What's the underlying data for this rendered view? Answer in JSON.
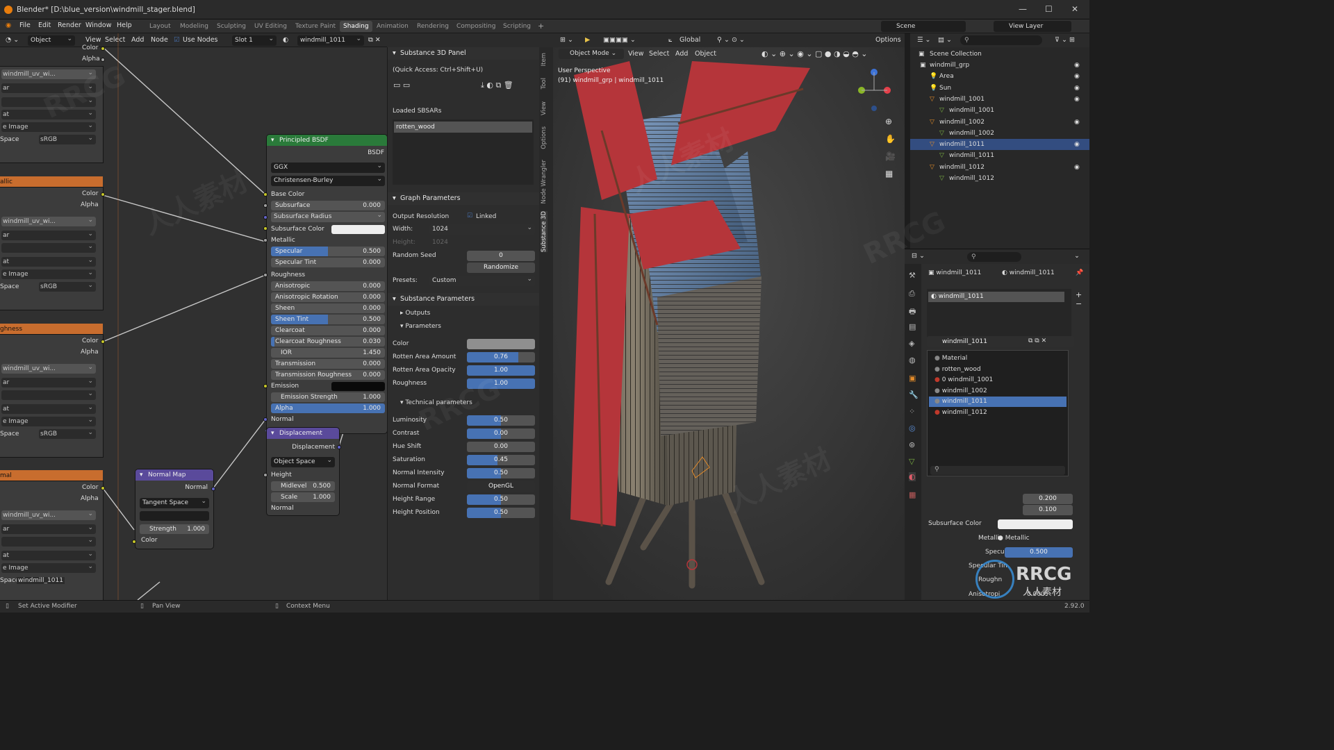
{
  "window": {
    "title": "Blender* [D:\\blue_version\\windmill_stager.blend]",
    "controls": [
      "—",
      "☐",
      "✕"
    ]
  },
  "menu": {
    "items": [
      "File",
      "Edit",
      "Render",
      "Window",
      "Help"
    ]
  },
  "workspaces": [
    "Layout",
    "Modeling",
    "Sculpting",
    "UV Editing",
    "Texture Paint",
    "Shading",
    "Animation",
    "Rendering",
    "Compositing",
    "Scripting"
  ],
  "active_workspace": "Shading",
  "scene": {
    "scene": "Scene",
    "view_layer": "View Layer"
  },
  "node_header": {
    "object": "Object",
    "view": "View",
    "select": "Select",
    "add": "Add",
    "node": "Node",
    "use_nodes": "Use Nodes",
    "slot": "Slot 1",
    "material": "windmill_1011"
  },
  "image_nodes": {
    "color": "Color",
    "alpha": "Alpha",
    "image": "windmill_uv_wi...",
    "space_label": "Space",
    "space": "sRGB",
    "image_label": "e Image",
    "r1": "ar",
    "r2": "at",
    "metallic_title": "allic",
    "roughness_title": "ghness",
    "normal_title": "mal",
    "top_color": "Color"
  },
  "principled": {
    "title": "Principled BSDF",
    "bsdf": "BSDF",
    "distribution": "GGX",
    "subsurface_method": "Christensen-Burley",
    "base_color": "Base Color",
    "subsurface": {
      "label": "Subsurface",
      "value": "0.000"
    },
    "subsurface_radius": "Subsurface Radius",
    "subsurface_color": "Subsurface Color",
    "metallic": "Metallic",
    "specular": {
      "label": "Specular",
      "value": "0.500"
    },
    "specular_tint": {
      "label": "Specular Tint",
      "value": "0.000"
    },
    "roughness": "Roughness",
    "anisotropic": {
      "label": "Anisotropic",
      "value": "0.000"
    },
    "anisotropic_rotation": {
      "label": "Anisotropic Rotation",
      "value": "0.000"
    },
    "sheen": {
      "label": "Sheen",
      "value": "0.000"
    },
    "sheen_tint": {
      "label": "Sheen Tint",
      "value": "0.500"
    },
    "clearcoat": {
      "label": "Clearcoat",
      "value": "0.000"
    },
    "clearcoat_roughness": {
      "label": "Clearcoat Roughness",
      "value": "0.030"
    },
    "ior": {
      "label": "IOR",
      "value": "1.450"
    },
    "transmission": {
      "label": "Transmission",
      "value": "0.000"
    },
    "transmission_roughness": {
      "label": "Transmission Roughness",
      "value": "0.000"
    },
    "emission": "Emission",
    "emission_strength": {
      "label": "Emission Strength",
      "value": "1.000"
    },
    "alpha": {
      "label": "Alpha",
      "value": "1.000"
    },
    "normal": "Normal"
  },
  "displacement": {
    "title": "Displacement",
    "out": "Displacement",
    "space": "Object Space",
    "height": "Height",
    "midlevel": {
      "label": "Midlevel",
      "value": "0.500"
    },
    "scale": {
      "label": "Scale",
      "value": "1.000"
    },
    "normal": "Normal"
  },
  "normal_map": {
    "title": "Normal Map",
    "normal": "Normal",
    "space": "Tangent Space",
    "strength": {
      "label": "Strength",
      "value": "1.000"
    },
    "color": "Color"
  },
  "bottom_overlay": "windmill_1011",
  "substance": {
    "panel_title": "Substance 3D Panel",
    "quick_access": "(Quick Access: Ctrl+Shift+U)",
    "loaded_label": "Loaded SBSARs",
    "loaded_item": "rotten_wood",
    "graph_title": "Graph Parameters",
    "output_res": "Output Resolution",
    "linked": "Linked",
    "width_label": "Width:",
    "width": "1024",
    "height_label": "Height:",
    "height": "1024",
    "seed_label": "Random Seed",
    "seed": "0",
    "randomize": "Randomize",
    "presets_label": "Presets:",
    "presets": "Custom",
    "params_title": "Substance Parameters",
    "outputs": "Outputs",
    "parameters": "Parameters",
    "params": [
      {
        "label": "Color",
        "value": "",
        "fill": 0
      },
      {
        "label": "Rotten Area Amount",
        "value": "0.76",
        "fill": 0.76
      },
      {
        "label": "Rotten Area Opacity",
        "value": "1.00",
        "fill": 1
      },
      {
        "label": "Roughness",
        "value": "1.00",
        "fill": 1
      }
    ],
    "tech_title": "Technical parameters",
    "tech": [
      {
        "label": "Luminosity",
        "value": "0.50",
        "fill": 0.5
      },
      {
        "label": "Contrast",
        "value": "0.00",
        "fill": 0.5
      },
      {
        "label": "Hue Shift",
        "value": "0.00",
        "fill": 0
      },
      {
        "label": "Saturation",
        "value": "0.45",
        "fill": 0.45
      },
      {
        "label": "Normal Intensity",
        "value": "0.50",
        "fill": 0.5
      },
      {
        "label": "Normal Format",
        "value": "OpenGL",
        "fill": 0
      },
      {
        "label": "Height Range",
        "value": "0.50",
        "fill": 0.5
      },
      {
        "label": "Height Position",
        "value": "0.50",
        "fill": 0.5
      }
    ]
  },
  "sidebar_tabs": [
    "Item",
    "Tool",
    "View",
    "Options",
    "Node Wrangler",
    "Substance 3D"
  ],
  "viewport": {
    "mode": "Object Mode",
    "view": "View",
    "select": "Select",
    "add": "Add",
    "object": "Object",
    "orientation": "Global",
    "options": "Options",
    "line1": "User Perspective",
    "line2": "(91) windmill_grp | windmill_1011"
  },
  "outliner": {
    "root": "Scene Collection",
    "items": [
      {
        "label": "windmill_grp",
        "type": "collection"
      },
      {
        "label": "Area",
        "type": "light"
      },
      {
        "label": "Sun",
        "type": "light"
      },
      {
        "label": "windmill_1001",
        "type": "object"
      },
      {
        "label": "windmill_1001",
        "type": "mesh"
      },
      {
        "label": "windmill_1002",
        "type": "object"
      },
      {
        "label": "windmill_1002",
        "type": "mesh"
      },
      {
        "label": "windmill_1011",
        "type": "object"
      },
      {
        "label": "windmill_1011",
        "type": "mesh"
      },
      {
        "label": "windmill_1012",
        "type": "object"
      },
      {
        "label": "windmill_1012",
        "type": "mesh"
      }
    ]
  },
  "properties": {
    "object": "windmill_1011",
    "material_tab": "windmill_1011",
    "slot": "windmill_1011",
    "material": "windmill_1011",
    "materials": [
      "Material",
      "rotten_wood",
      "0 windmill_1001",
      "windmill_1002",
      "windmill_1011",
      "windmill_1012"
    ],
    "radius_values": [
      "0.200",
      "0.100"
    ],
    "subsurface_color": "Subsurface Color",
    "metallic_label": "Metallic",
    "metallic_link": "Metallic",
    "specular_label": "Specular",
    "specular_value": "0.500",
    "specular_tint": "Specular Tin",
    "roughness": "Roughn",
    "anisotropic": "Anisotropi",
    "aniso_value": "0.000"
  },
  "status": {
    "set_modifier": "Set Active Modifier",
    "pan": "Pan View",
    "context": "Context Menu",
    "version": "2.92.0"
  },
  "watermarks": [
    "RRCG",
    "人人素材"
  ]
}
